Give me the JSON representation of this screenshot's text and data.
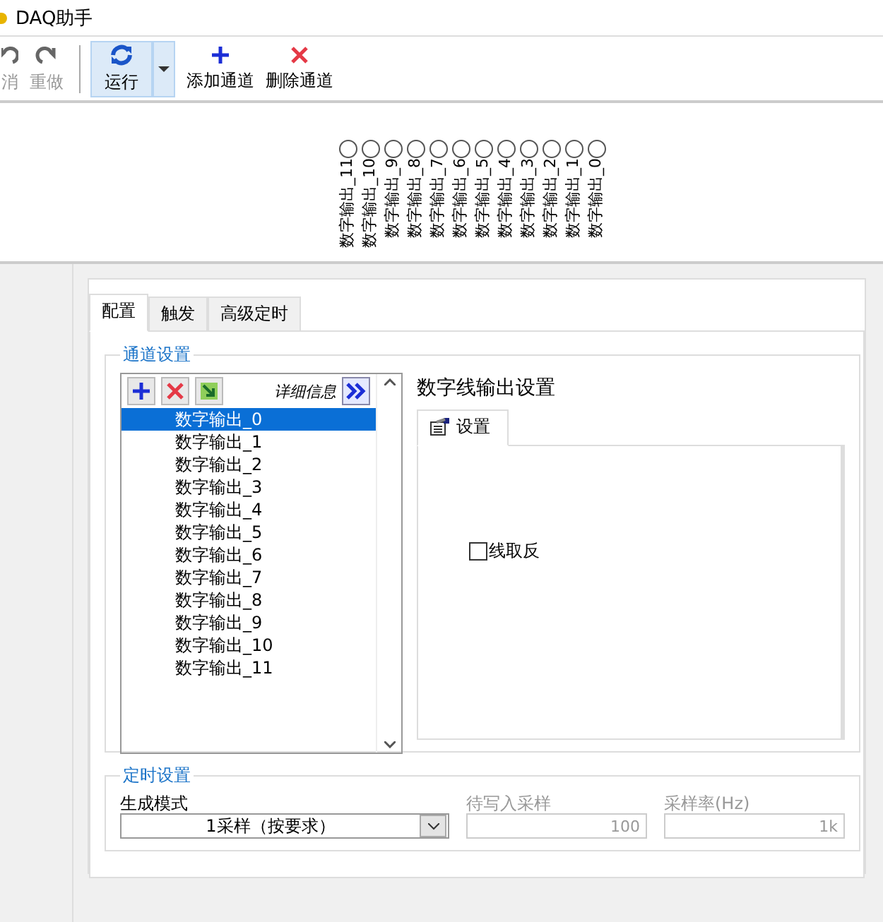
{
  "window": {
    "title": "DAQ助手"
  },
  "toolbar": [
    {
      "kind": "undo",
      "label": "消",
      "disabled": true
    },
    {
      "kind": "redo",
      "label": "重做",
      "disabled": true
    },
    {
      "kind": "run",
      "label": "运行",
      "disabled": false
    },
    {
      "kind": "add",
      "label": "添加通道",
      "disabled": false
    },
    {
      "kind": "delete",
      "label": "删除通道",
      "disabled": false
    }
  ],
  "leds": [
    {
      "label": "数字输出_11",
      "on": false
    },
    {
      "label": "数字输出_10",
      "on": false
    },
    {
      "label": "数字输出_9",
      "on": false
    },
    {
      "label": "数字输出_8",
      "on": false
    },
    {
      "label": "数字输出_7",
      "on": false
    },
    {
      "label": "数字输出_6",
      "on": false
    },
    {
      "label": "数字输出_5",
      "on": false
    },
    {
      "label": "数字输出_4",
      "on": false
    },
    {
      "label": "数字输出_3",
      "on": false
    },
    {
      "label": "数字输出_2",
      "on": false
    },
    {
      "label": "数字输出_1",
      "on": false
    },
    {
      "label": "数字输出_0",
      "on": false
    }
  ],
  "tabs": [
    {
      "label": "配置",
      "selected": true
    },
    {
      "label": "触发",
      "selected": false
    },
    {
      "label": "高级定时",
      "selected": false
    }
  ],
  "channel_settings": {
    "title": "通道设置",
    "details_label": "详细信息",
    "channels": [
      {
        "name": "数字输出_0",
        "selected": true
      },
      {
        "name": "数字输出_1",
        "selected": false
      },
      {
        "name": "数字输出_2",
        "selected": false
      },
      {
        "name": "数字输出_3",
        "selected": false
      },
      {
        "name": "数字输出_4",
        "selected": false
      },
      {
        "name": "数字输出_5",
        "selected": false
      },
      {
        "name": "数字输出_6",
        "selected": false
      },
      {
        "name": "数字输出_7",
        "selected": false
      },
      {
        "name": "数字输出_8",
        "selected": false
      },
      {
        "name": "数字输出_9",
        "selected": false
      },
      {
        "name": "数字输出_10",
        "selected": false
      },
      {
        "name": "数字输出_11",
        "selected": false
      }
    ],
    "detail_title": "数字线输出设置",
    "detail_tab": "设置",
    "invert_line": {
      "label": "线取反",
      "checked": false
    }
  },
  "timing_settings": {
    "title": "定时设置",
    "generation_mode": {
      "label": "生成模式",
      "value": "1采样（按要求）"
    },
    "samples_to_write": {
      "label": "待写入采样",
      "value": "100",
      "disabled": true
    },
    "rate": {
      "label": "采样率(Hz)",
      "value": "1k",
      "disabled": true
    }
  }
}
